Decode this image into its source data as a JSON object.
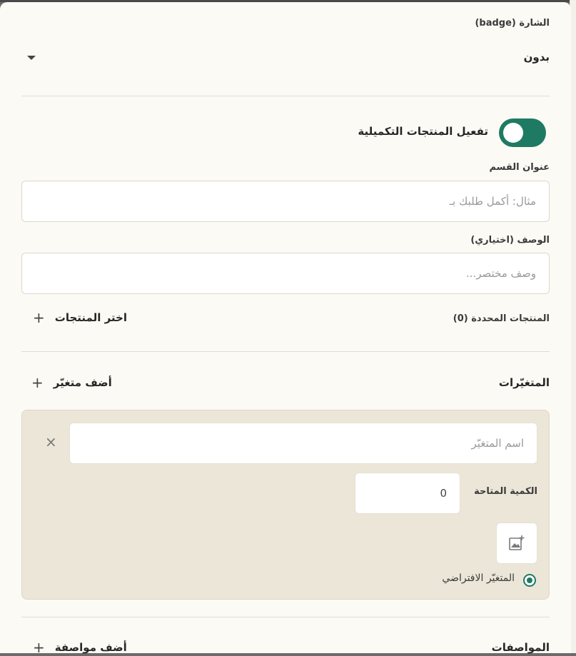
{
  "badge": {
    "label": "الشارة (badge)",
    "value": "بدون"
  },
  "complementary": {
    "toggle_label": "تفعيل المنتجات التكميلية",
    "enabled": true
  },
  "section_title": {
    "label": "عنوان القسم",
    "placeholder": "مثال: أكمل طلبك بـ"
  },
  "description": {
    "label": "الوصف (اختياري)",
    "placeholder": "وصف مختصر..."
  },
  "selected_products": {
    "label": "المنتجات المحددة (0)",
    "choose_label": "اختر المنتجات"
  },
  "variants": {
    "heading": "المتغيّرات",
    "add_label": "أضف متغيّر",
    "items": [
      {
        "name_placeholder": "اسم المتغيّر",
        "quantity_label": "الكمية المتاحة",
        "quantity_value": "0",
        "default_label": "المتغيّر الافتراضي",
        "is_default": true
      }
    ]
  },
  "specs": {
    "heading": "المواصفات",
    "add_label": "أضف مواصفة"
  },
  "icons": {
    "dropdown": "caret-down-icon",
    "close": "close-icon",
    "image_add": "add-image-icon",
    "plus": "plus-icon"
  },
  "colors": {
    "accent": "#1f7a64",
    "panel": "#fcfaf4",
    "variant_bg": "#ebe6d8"
  }
}
